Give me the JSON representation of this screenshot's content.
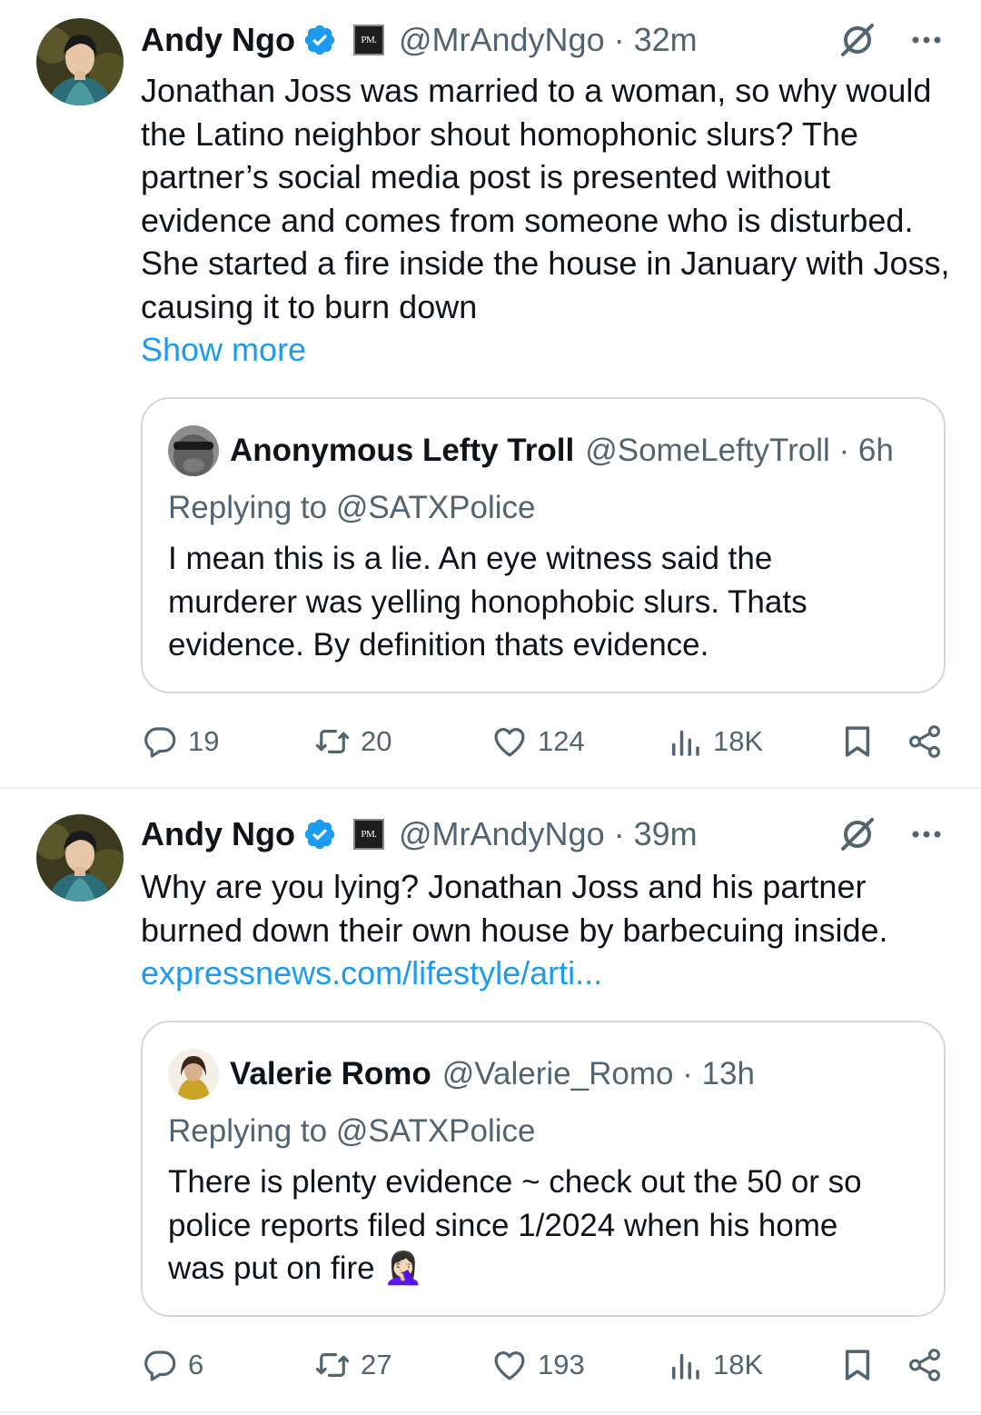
{
  "colors": {
    "link": "#1d9bf0",
    "secondary_text": "#536471",
    "verified": "#1d9bf0",
    "border": "#cfd9de"
  },
  "tweets": [
    {
      "author": {
        "name": "Andy Ngo",
        "badge_text": "PM.",
        "handle_time": "@MrAndyNgo · 32m"
      },
      "lines": [
        "Jonathan Joss was married to a woman, so why would",
        "the Latino neighbor shout homophonic slurs? The",
        "partner’s social media post is presented without",
        "evidence and comes from someone who is disturbed.",
        "She started a fire inside the house in January with Joss,",
        "causing it to burn down"
      ],
      "show_more": "Show more",
      "quote": {
        "name": "Anonymous Lefty Troll",
        "handle_time": "@SomeLeftyTroll · 6h",
        "replying_to": "Replying to @SATXPolice",
        "lines": [
          "I mean this is a lie. An eye witness said the",
          "murderer was yelling honophobic slurs. Thats",
          "evidence. By definition thats evidence."
        ]
      },
      "stats": {
        "replies": "19",
        "reposts": "20",
        "likes": "124",
        "views": "18K"
      }
    },
    {
      "author": {
        "name": "Andy Ngo",
        "badge_text": "PM.",
        "handle_time": "@MrAndyNgo · 39m"
      },
      "lines": [
        "Why are you lying? Jonathan Joss and his partner",
        "burned down their own house by barbecuing inside."
      ],
      "link": "expressnews.com/lifestyle/arti...",
      "quote": {
        "name": "Valerie Romo",
        "handle_time": "@Valerie_Romo · 13h",
        "replying_to": "Replying to @SATXPolice",
        "lines": [
          "There is plenty evidence ~ check out the 50 or so",
          "police reports filed since 1/2024 when his home",
          "was put on fire 🤦🏻‍♀️"
        ]
      },
      "stats": {
        "replies": "6",
        "reposts": "27",
        "likes": "193",
        "views": "18K"
      }
    }
  ]
}
